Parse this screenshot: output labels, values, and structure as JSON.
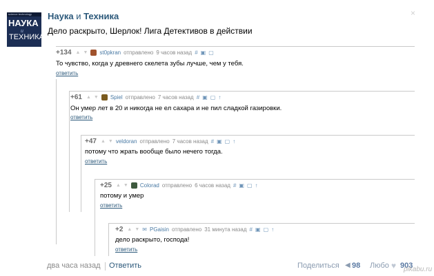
{
  "group": {
    "logo_small_text": "science technology",
    "logo_word1": "НАУКА",
    "logo_word2": "и",
    "logo_word3": "ТЕХНИКА",
    "name_part1": "Наука",
    "name_amp": " и ",
    "name_part2": "Техника",
    "close_icon": "×"
  },
  "post": {
    "title": "Дело раскрыто, Шерлок! Лига Детективов в действии"
  },
  "comments": [
    {
      "score": "+134",
      "username": "st0pkran",
      "sent_label": "отправлено",
      "time": "9 часов назад",
      "text": "То чувство, когда у древнего скелета зубы лучше, чем у тебя.",
      "reply": "ответить",
      "avatar_color": "#a0522d"
    },
    {
      "score": "+61",
      "username": "Spiel",
      "sent_label": "отправлено",
      "time": "7 часов назад",
      "text": "Он умер лет в 20 и никогда не ел сахара и не пил сладкой газировки.",
      "reply": "ответить",
      "avatar_color": "#7a5a1e"
    },
    {
      "score": "+47",
      "username": "veldoran",
      "sent_label": "отправлено",
      "time": "7 часов назад",
      "text": "потому что жрать вообще было нечего тогда.",
      "reply": "ответить",
      "avatar_color": ""
    },
    {
      "score": "+25",
      "username": "Colorad",
      "sent_label": "отправлено",
      "time": "6 часов назад",
      "text": "потому и умер",
      "reply": "ответить",
      "avatar_color": "#3e5a3e"
    },
    {
      "score": "+2",
      "username": "PGaisin",
      "sent_label": "отправлено",
      "time": "31 минута назад",
      "text": "дело раскрыто, господа!",
      "reply": "ответить",
      "avatar_color": "#8aa2c0"
    }
  ],
  "footer": {
    "time": "два часа назад",
    "reply": "Ответить",
    "share_label": "Поделиться",
    "share_count": "98",
    "like_label": "Любо",
    "like_count": "903"
  },
  "watermark": "pikabu.ru",
  "colors": {
    "link": "#2b587a",
    "username": "#4a7aa4",
    "meta_gray": "#8a8a8a"
  }
}
